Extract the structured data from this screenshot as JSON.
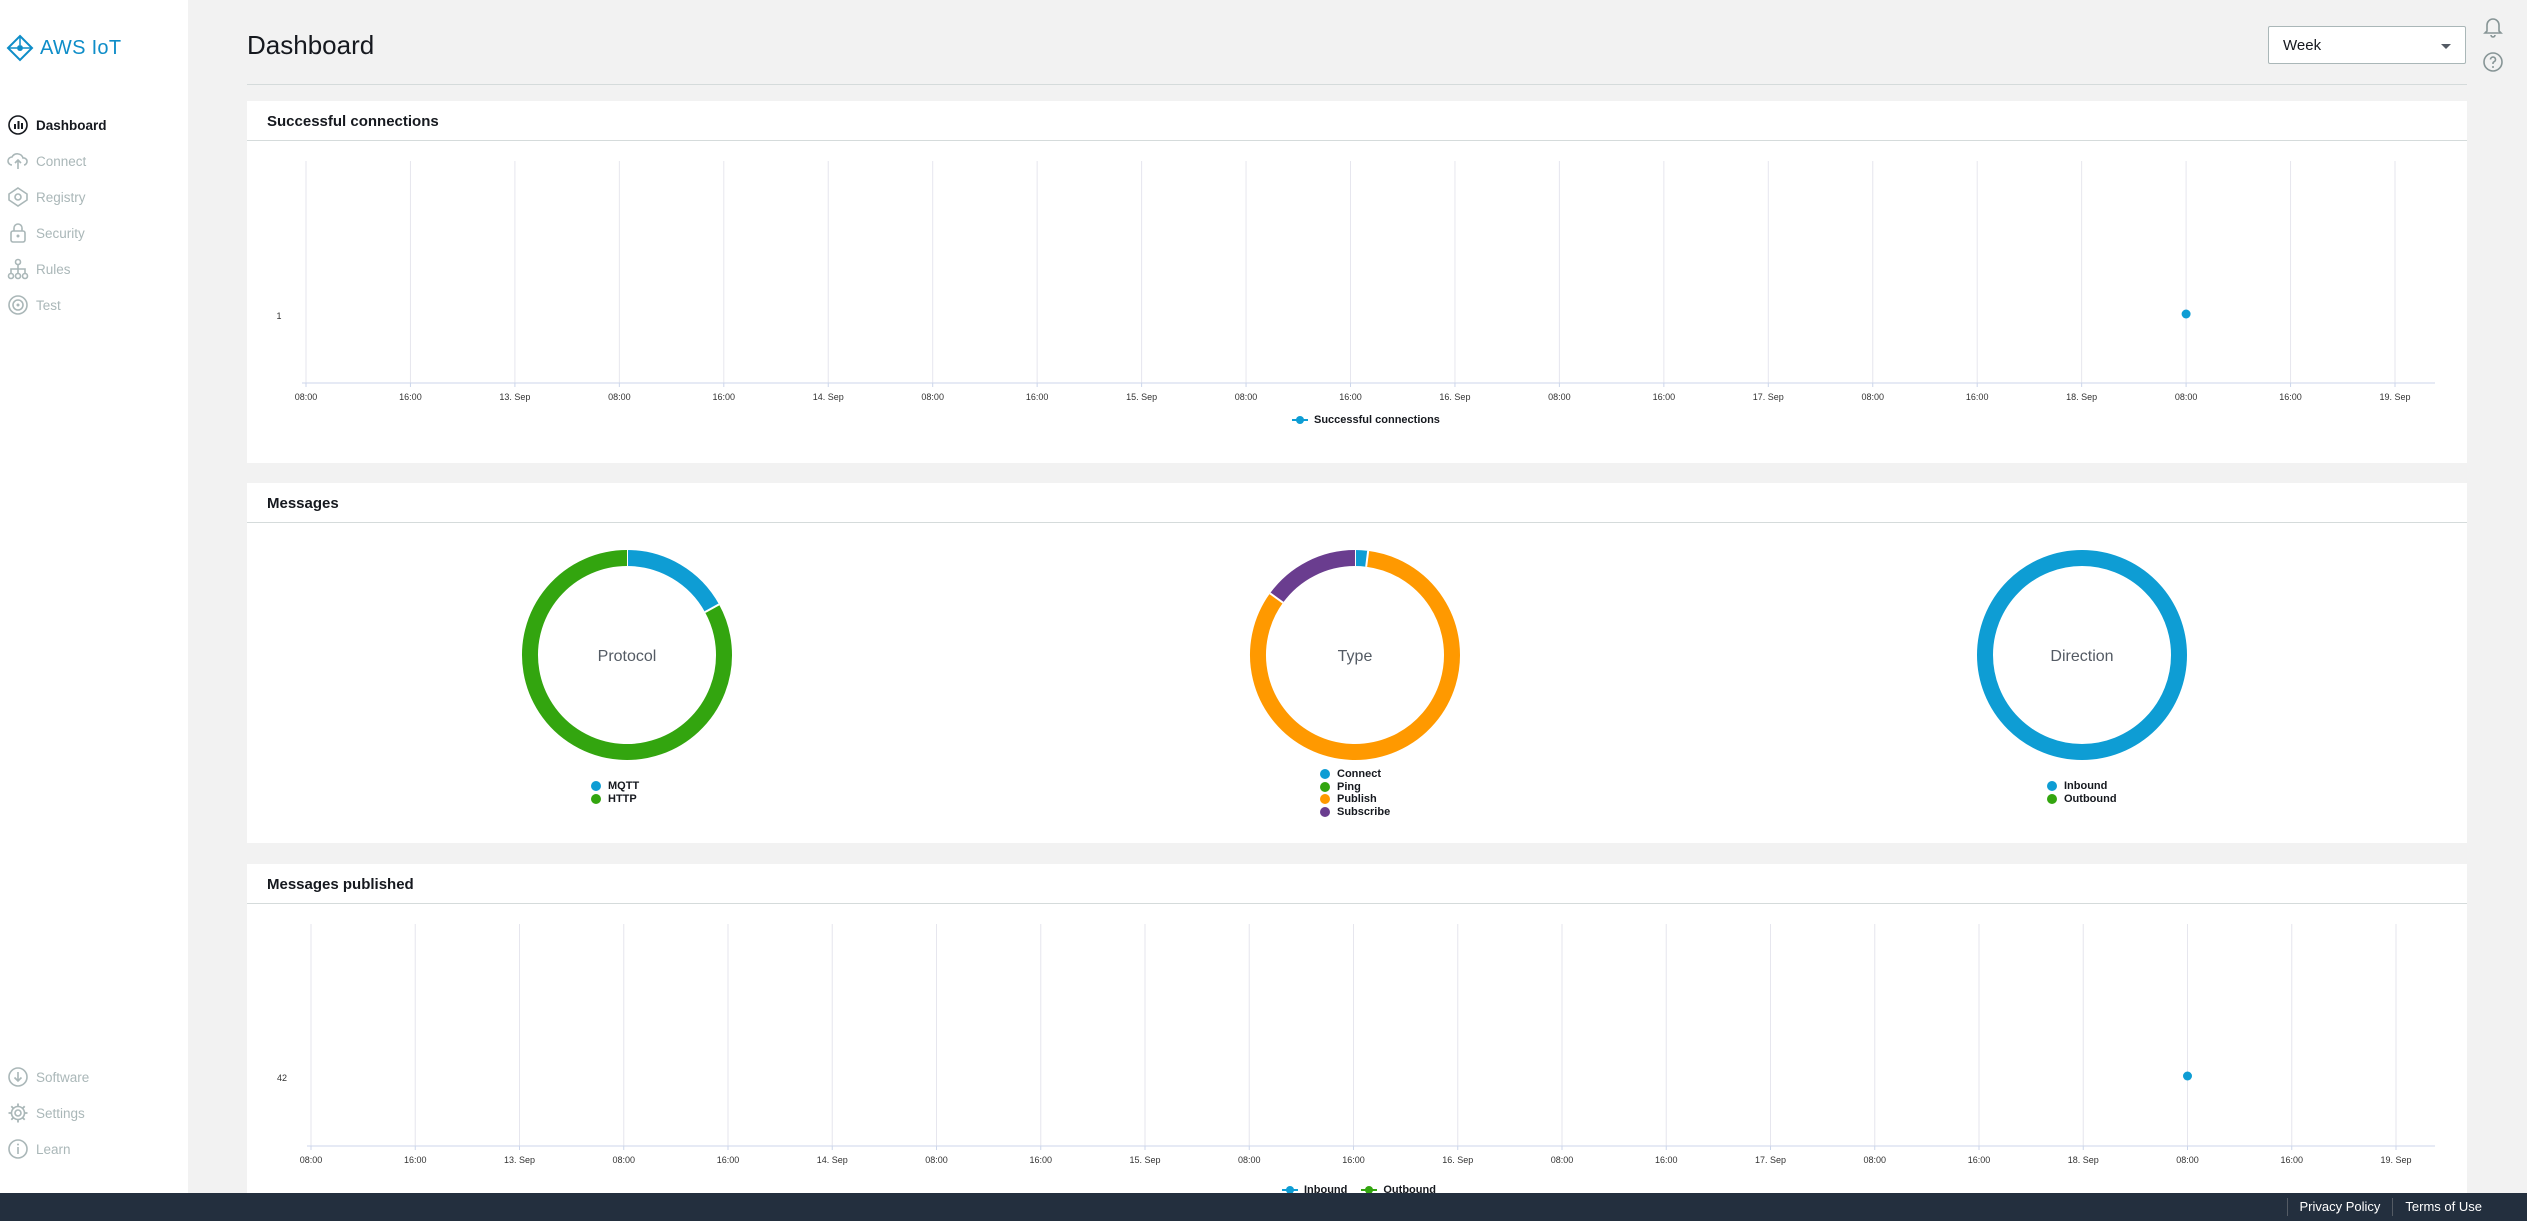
{
  "brand": {
    "name": "AWS IoT"
  },
  "nav": {
    "items": [
      {
        "label": "Dashboard",
        "icon": "dashboard-icon"
      },
      {
        "label": "Connect",
        "icon": "cloud-upload-icon"
      },
      {
        "label": "Registry",
        "icon": "registry-icon"
      },
      {
        "label": "Security",
        "icon": "lock-icon"
      },
      {
        "label": "Rules",
        "icon": "rules-icon"
      },
      {
        "label": "Test",
        "icon": "test-icon"
      }
    ],
    "bottom_items": [
      {
        "label": "Software",
        "icon": "download-icon"
      },
      {
        "label": "Settings",
        "icon": "gear-icon"
      },
      {
        "label": "Learn",
        "icon": "info-icon"
      }
    ]
  },
  "header": {
    "title": "Dashboard",
    "range_select": "Week"
  },
  "colors": {
    "blue": "#0e9dd4",
    "green": "#33a50f",
    "orange": "#ff9900",
    "purple": "#6a3d8f"
  },
  "panels": {
    "connections": {
      "title": "Successful connections"
    },
    "messages": {
      "title": "Messages"
    },
    "published": {
      "title": "Messages published"
    }
  },
  "footer": {
    "privacy": "Privacy Policy",
    "terms": "Terms of Use"
  },
  "chart_data": [
    {
      "type": "scatter",
      "title": "Successful connections",
      "x_ticks": [
        "08:00",
        "16:00",
        "13. Sep",
        "08:00",
        "16:00",
        "14. Sep",
        "08:00",
        "16:00",
        "15. Sep",
        "08:00",
        "16:00",
        "16. Sep",
        "08:00",
        "16:00",
        "17. Sep",
        "08:00",
        "16:00",
        "18. Sep",
        "08:00",
        "16:00",
        "19. Sep"
      ],
      "y_ticks": [
        "1"
      ],
      "series": [
        {
          "name": "Successful connections",
          "color": "#0e9dd4",
          "points": [
            {
              "x": "18. Sep 08:00",
              "y": 1
            }
          ]
        }
      ],
      "grid": true,
      "legend": "bottom"
    },
    {
      "type": "pie",
      "title": "Protocol",
      "series": [
        {
          "name": "MQTT",
          "value": 17,
          "color": "#0e9dd4"
        },
        {
          "name": "HTTP",
          "value": 83,
          "color": "#33a50f"
        }
      ],
      "legend": "bottom"
    },
    {
      "type": "pie",
      "title": "Type",
      "series": [
        {
          "name": "Connect",
          "value": 2,
          "color": "#0e9dd4"
        },
        {
          "name": "Ping",
          "value": 0,
          "color": "#33a50f"
        },
        {
          "name": "Publish",
          "value": 83,
          "color": "#ff9900"
        },
        {
          "name": "Subscribe",
          "value": 15,
          "color": "#6a3d8f"
        }
      ],
      "legend": "bottom"
    },
    {
      "type": "pie",
      "title": "Direction",
      "series": [
        {
          "name": "Inbound",
          "value": 100,
          "color": "#0e9dd4"
        },
        {
          "name": "Outbound",
          "value": 0,
          "color": "#33a50f"
        }
      ],
      "legend": "bottom"
    },
    {
      "type": "scatter",
      "title": "Messages published",
      "x_ticks": [
        "08:00",
        "16:00",
        "13. Sep",
        "08:00",
        "16:00",
        "14. Sep",
        "08:00",
        "16:00",
        "15. Sep",
        "08:00",
        "16:00",
        "16. Sep",
        "08:00",
        "16:00",
        "17. Sep",
        "08:00",
        "16:00",
        "18. Sep",
        "08:00",
        "16:00",
        "19. Sep"
      ],
      "y_ticks": [
        "42"
      ],
      "series": [
        {
          "name": "Inbound",
          "color": "#0e9dd4",
          "points": [
            {
              "x": "18. Sep 08:00",
              "y": 42
            }
          ]
        },
        {
          "name": "Outbound",
          "color": "#33a50f",
          "points": []
        }
      ],
      "grid": true,
      "legend": "bottom"
    }
  ]
}
